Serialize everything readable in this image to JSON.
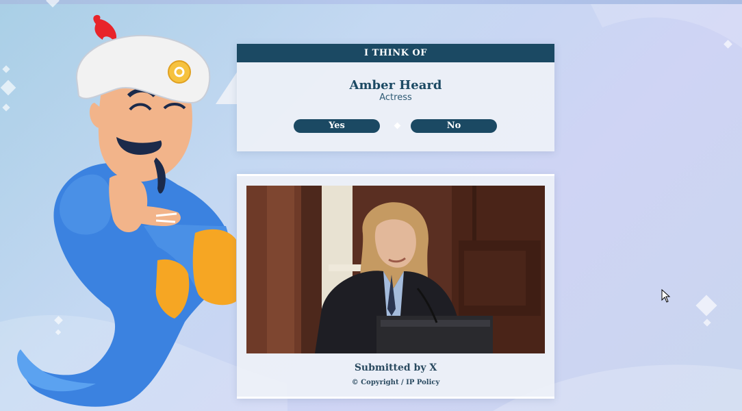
{
  "guess": {
    "header": "I THINK OF",
    "name": "Amber Heard",
    "description": "Actress",
    "yes_label": "Yes",
    "no_label": "No"
  },
  "submission": {
    "submitted_by": "Submitted by X",
    "copyright": "© Copyright / IP Policy"
  },
  "icons": {
    "separator": "diamond-icon",
    "cursor": "mouse-pointer-icon"
  },
  "colors": {
    "primary": "#1b4963",
    "card_bg": "#eef1f7",
    "genie_blue": "#3b82e0",
    "turban": "#f2f2f2",
    "sash": "#f6a623",
    "flame": "#e8242a"
  }
}
